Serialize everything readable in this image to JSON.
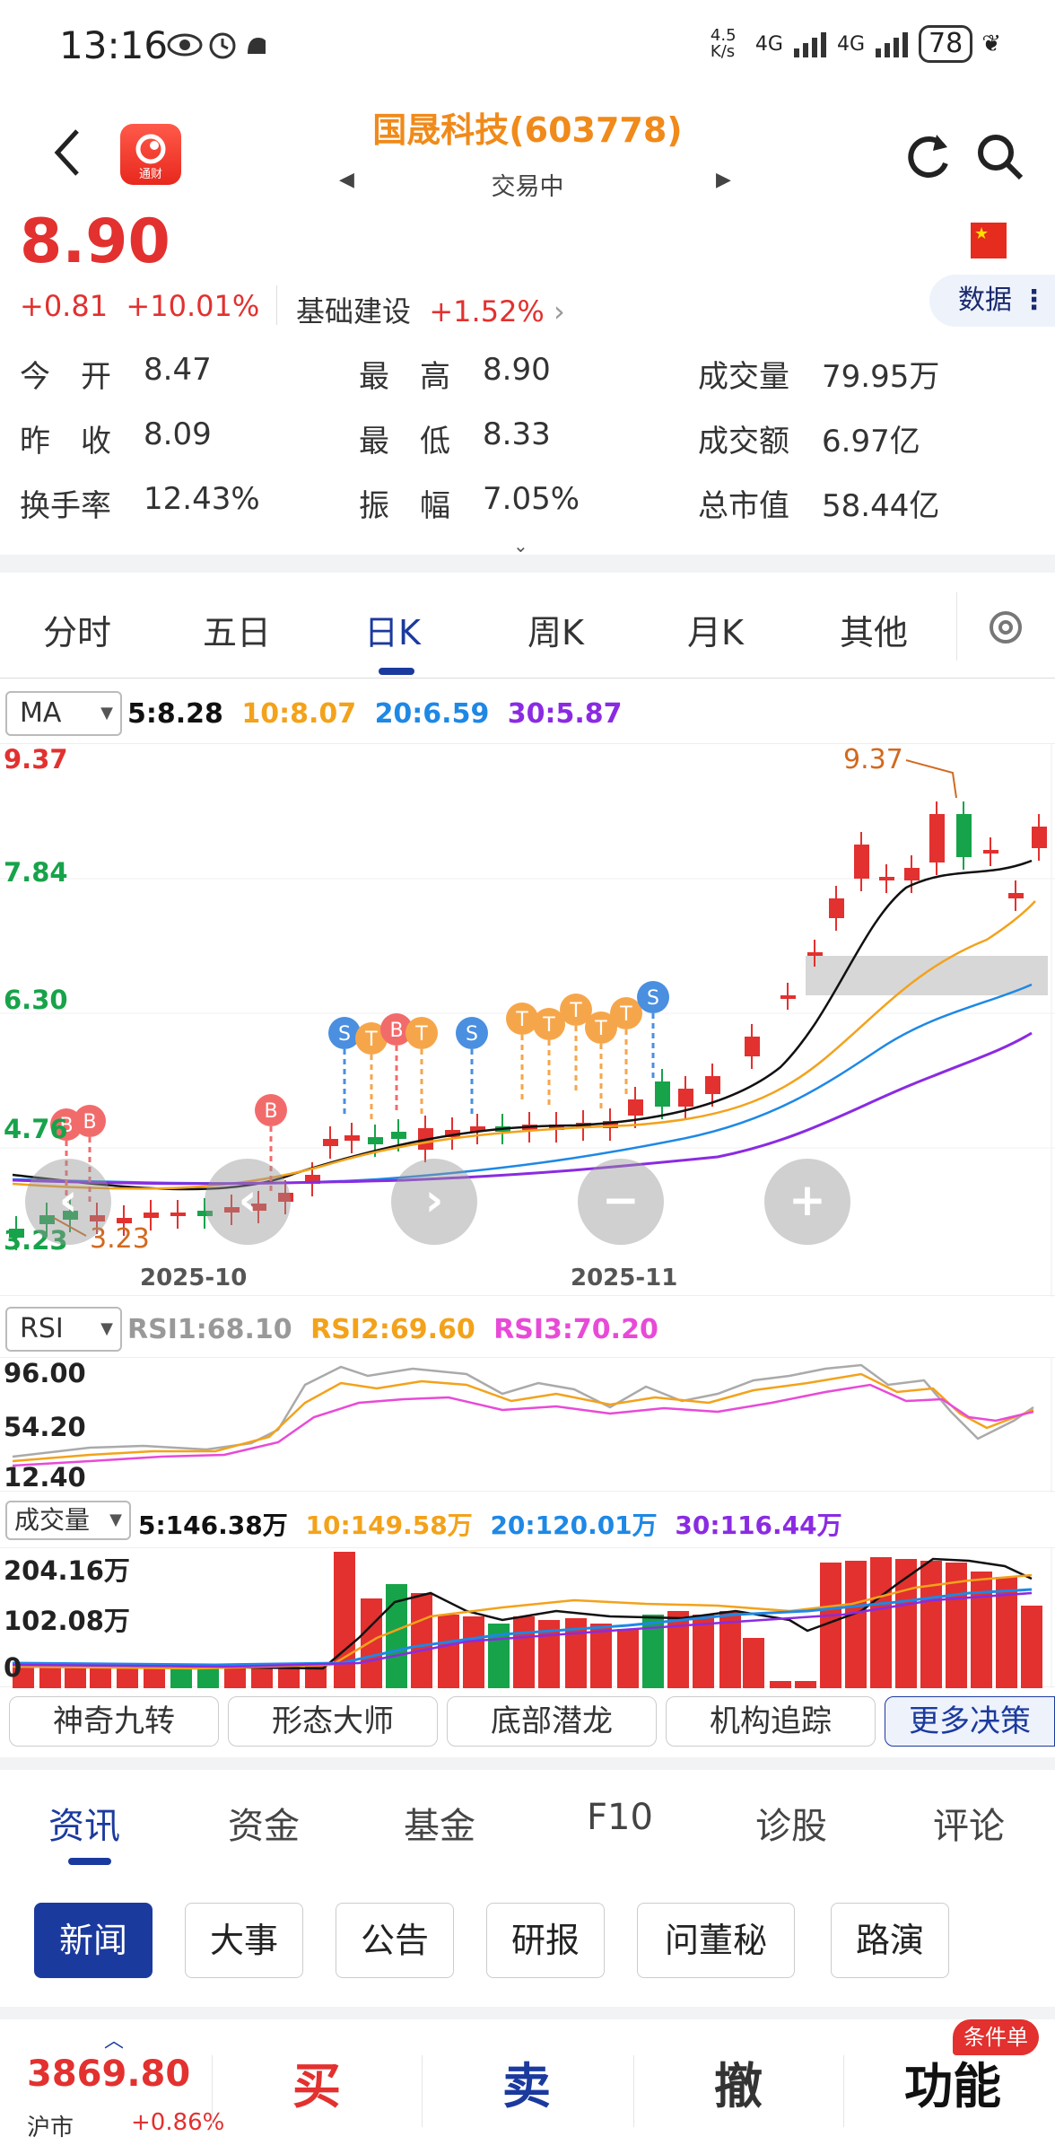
{
  "status": {
    "time": "13:16",
    "speed": "4.5 K/s",
    "net1": "4G",
    "net2": "4G",
    "battery": "78"
  },
  "header": {
    "title": "国晟科技(603778)",
    "subtitle": "交易中",
    "logo_text": "通财"
  },
  "quote": {
    "price": "8.90",
    "change": "+0.81",
    "change_pct": "+10.01%",
    "sector_name": "基础建设",
    "sector_pct": "+1.52%",
    "data_button": "数据",
    "rows": [
      [
        {
          "k": "今　开",
          "v": "8.47"
        },
        {
          "k": "最　高",
          "v": "8.90"
        },
        {
          "k": "成交量",
          "v": "79.95万"
        }
      ],
      [
        {
          "k": "昨　收",
          "v": "8.09"
        },
        {
          "k": "最　低",
          "v": "8.33"
        },
        {
          "k": "成交额",
          "v": "6.97亿"
        }
      ],
      [
        {
          "k": "换手率",
          "v": "12.43%"
        },
        {
          "k": "振　幅",
          "v": "7.05%"
        },
        {
          "k": "总市值",
          "v": "58.44亿"
        }
      ]
    ]
  },
  "chart_tabs": [
    "分时",
    "五日",
    "日K",
    "周K",
    "月K",
    "其他"
  ],
  "ma": {
    "selector": "MA",
    "ma5": "5:8.28",
    "ma10": "10:8.07",
    "ma20": "20:6.59",
    "ma30": "30:5.87"
  },
  "kline_axis": {
    "top": "9.37",
    "mid1": "7.84",
    "mid2": "6.30",
    "mid3": "4.76",
    "bottom": "3.23",
    "max_label": "9.37",
    "min_label": "3.23",
    "date1": "2025-10",
    "date2": "2025-11"
  },
  "rsi": {
    "selector": "RSI",
    "rsi1": "RSI1:68.10",
    "rsi2": "RSI2:69.60",
    "rsi3": "RSI3:70.20",
    "top": "96.00",
    "mid": "54.20",
    "bottom": "12.40"
  },
  "volume": {
    "selector": "成交量",
    "v5": "5:146.38万",
    "v10": "10:149.58万",
    "v20": "20:120.01万",
    "v30": "30:116.44万",
    "top": "204.16万",
    "mid": "102.08万",
    "bottom": "0"
  },
  "chart_controls": {
    "prev": "‹",
    "next": "›",
    "zoom_out": "−",
    "zoom_in": "+"
  },
  "chips": [
    "神奇九转",
    "形态大师",
    "底部潜龙",
    "机构追踪",
    "更多决策"
  ],
  "info_tabs": [
    "资讯",
    "资金",
    "基金",
    "F10",
    "诊股",
    "评论"
  ],
  "sub_tabs": [
    "新闻",
    "大事",
    "公告",
    "研报",
    "问董秘",
    "路演"
  ],
  "bottom": {
    "index_value": "3869.80",
    "index_name": "沪市",
    "index_change": "+0.86%",
    "buy": "买",
    "sell": "卖",
    "cancel": "撤",
    "func": "功能",
    "badge": "条件单"
  },
  "colors": {
    "up": "#e2312f",
    "down": "#17a34a",
    "accent": "#1b3a9e",
    "ma5": "#111111",
    "ma10": "#f3a21b",
    "ma20": "#1e88e5",
    "ma30": "#8a2be2"
  }
}
